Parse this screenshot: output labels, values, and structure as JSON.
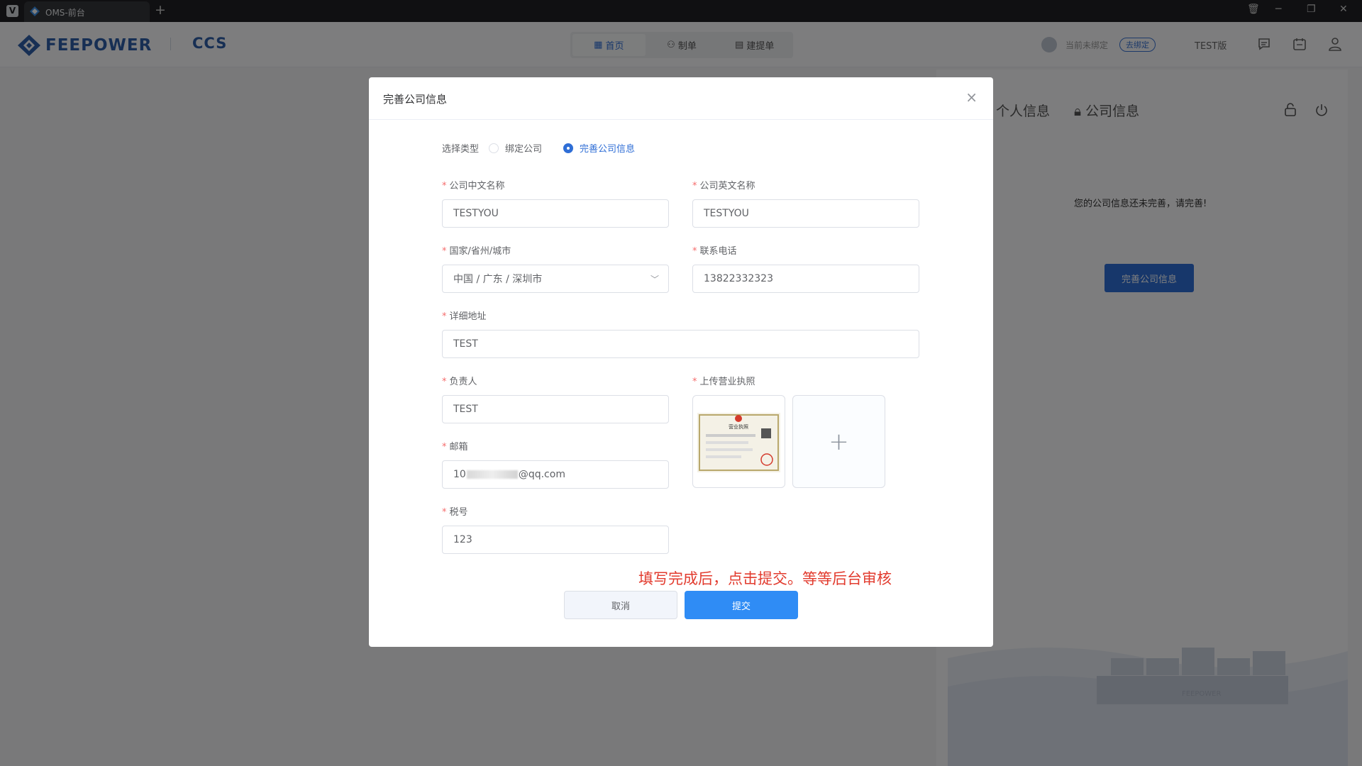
{
  "browser": {
    "tab_title": "OMS-前台",
    "new_tab": "+",
    "controls": [
      "🗑",
      "─",
      "❐",
      "✕"
    ]
  },
  "header": {
    "brand": "FEEPOWER",
    "brand_sub": "CCS",
    "nav": [
      {
        "label": "首页",
        "icon": "grid-icon",
        "active": true
      },
      {
        "label": "制单",
        "icon": "user-icon",
        "active": false
      },
      {
        "label": "建提单",
        "icon": "document-icon",
        "active": false
      }
    ],
    "bind_status": "当前未绑定",
    "bind_button": "去绑定",
    "edition": "TEST版"
  },
  "right_panel": {
    "tabs": [
      "个人信息",
      "公司信息"
    ],
    "message": "您的公司信息还未完善，请完善!",
    "button": "完善公司信息",
    "ship_label": "FEEPOWER"
  },
  "modal": {
    "title": "完善公司信息",
    "close": "×",
    "type_label": "选择类型",
    "type_options": [
      {
        "label": "绑定公司",
        "checked": false
      },
      {
        "label": "完善公司信息",
        "checked": true
      }
    ],
    "fields": {
      "cn_name": {
        "label": "公司中文名称",
        "value": "TESTYOU"
      },
      "en_name": {
        "label": "公司英文名称",
        "value": "TESTYOU"
      },
      "region": {
        "label": "国家/省州/城市",
        "value": "中国 / 广东 / 深圳市"
      },
      "phone": {
        "label": "联系电话",
        "value": "13822332323"
      },
      "address": {
        "label": "详细地址",
        "value": "TEST"
      },
      "contact": {
        "label": "负责人",
        "value": "TEST"
      },
      "email": {
        "label": "邮箱",
        "value_prefix": "10",
        "value_suffix": "@qq.com"
      },
      "tax": {
        "label": "税号",
        "value": "123"
      },
      "license": {
        "label": "上传营业执照",
        "preview_title": "营业执照"
      }
    },
    "add_symbol": "+",
    "note": "填写完成后，点击提交。等等后台审核",
    "cancel": "取消",
    "submit": "提交"
  },
  "colors": {
    "primary": "#2f6ed6",
    "submit": "#2f8cf5",
    "required": "#f56c6c",
    "note": "#e23b2e"
  }
}
